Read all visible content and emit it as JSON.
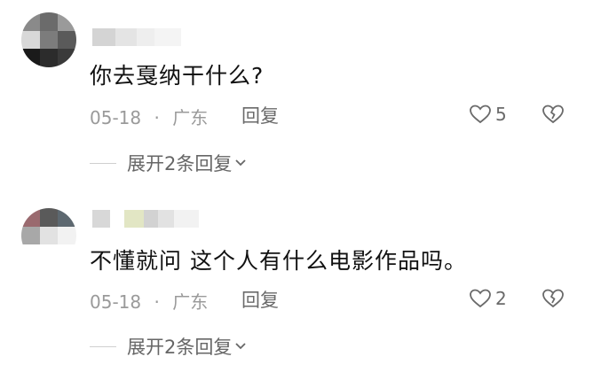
{
  "comments": [
    {
      "text": "你去戛纳干什么?",
      "date": "05-18",
      "separator": "·",
      "location": "广东",
      "reply_label": "回复",
      "likes": "5",
      "expand_label": "展开2条回复"
    },
    {
      "text": "不懂就问 这个人有什么电影作品吗。",
      "date": "05-18",
      "separator": "·",
      "location": "广东",
      "reply_label": "回复",
      "likes": "2",
      "expand_label": "展开2条回复"
    }
  ],
  "icons": {
    "like": "heart-outline-icon",
    "dislike": "broken-heart-icon",
    "expand": "chevron-down-icon"
  },
  "colors": {
    "text_primary": "#111111",
    "text_meta": "#9a9a9a",
    "action": "#6a6a6a"
  }
}
